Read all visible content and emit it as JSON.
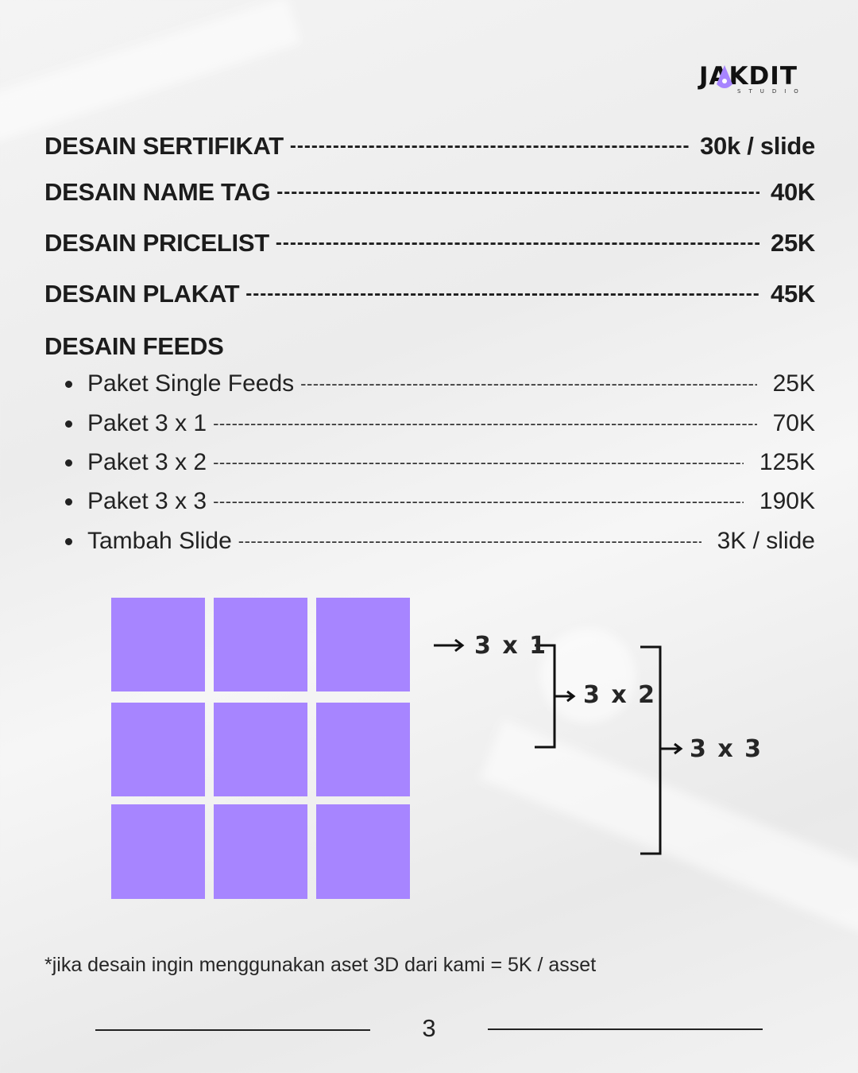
{
  "brand": {
    "logo_text": "JAKDIT",
    "logo_sub": "STUDIO",
    "accent": "#a785ff"
  },
  "prices": [
    {
      "label": "DESAIN SERTIFIKAT",
      "price": "30k / slide"
    },
    {
      "label": "DESAIN NAME TAG",
      "price": "40K"
    },
    {
      "label": "DESAIN PRICELIST",
      "price": "25K"
    },
    {
      "label": "DESAIN PLAKAT",
      "price": "45K"
    }
  ],
  "feeds": {
    "title": "DESAIN FEEDS",
    "items": [
      {
        "label": "Paket Single Feeds",
        "price": "25K"
      },
      {
        "label": "Paket 3 x 1",
        "price": "70K"
      },
      {
        "label": "Paket 3 x 2",
        "price": "125K"
      },
      {
        "label": "Paket 3 x 3",
        "price": "190K"
      },
      {
        "label": "Tambah Slide",
        "price": "3K / slide"
      }
    ]
  },
  "diagram": {
    "label_3x1": "3 x 1",
    "label_3x2": "3 x 2",
    "label_3x3": "3 x 3"
  },
  "footnote": "*jika desain ingin menggunakan aset 3D dari kami = 5K / asset",
  "page_number": "3"
}
